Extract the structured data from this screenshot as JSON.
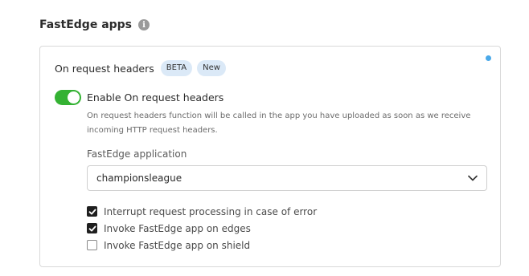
{
  "section": {
    "title": "FastEdge apps",
    "info_icon": "info-icon"
  },
  "card": {
    "title": "On request headers",
    "badges": [
      "BETA",
      "New"
    ],
    "status_dot_color": "#4aa9e9",
    "toggle": {
      "label": "Enable On request headers",
      "enabled": true,
      "color": "#34b233"
    },
    "description": "On request headers function will be called in the app you have uploaded as soon as we receive incoming HTTP request headers.",
    "application": {
      "label": "FastEdge application",
      "selected": "championsleague",
      "icon": "chevron-down-icon"
    },
    "options": [
      {
        "label": "Interrupt request processing in case of error",
        "checked": true
      },
      {
        "label": "Invoke FastEdge app on edges",
        "checked": true
      },
      {
        "label": "Invoke FastEdge app on shield",
        "checked": false
      }
    ]
  }
}
